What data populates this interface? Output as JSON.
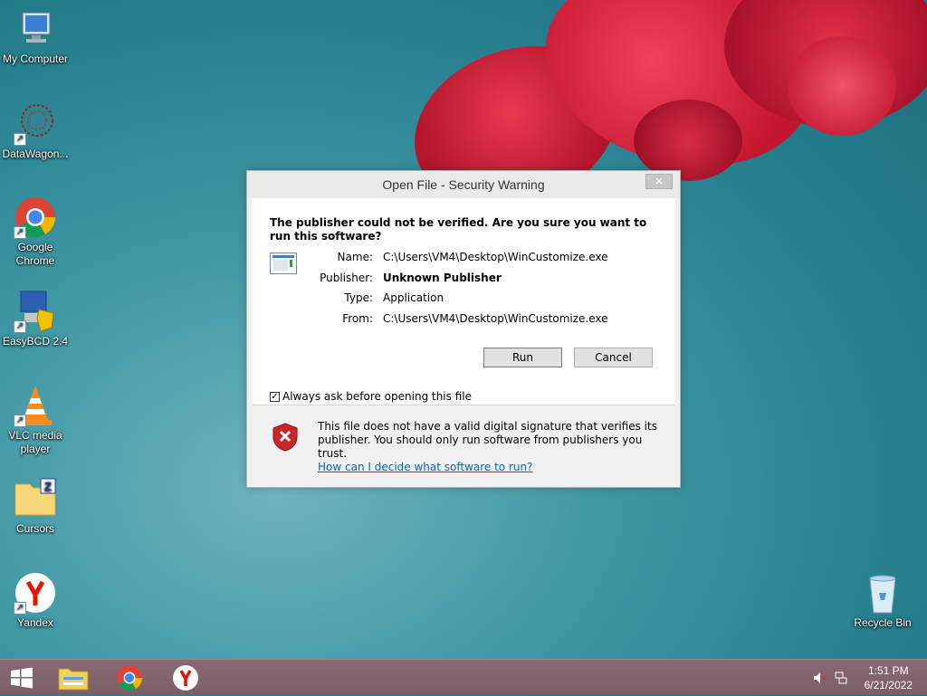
{
  "desktop": {
    "icons": [
      {
        "label": "My Computer"
      },
      {
        "label": "DataWagon..."
      },
      {
        "label": "Google\nChrome"
      },
      {
        "label": "EasyBCD 2.4"
      },
      {
        "label": "VLC media\nplayer"
      },
      {
        "label": "Cursors"
      },
      {
        "label": "Yandex"
      },
      {
        "label": "Recycle Bin"
      }
    ]
  },
  "dialog": {
    "title": "Open File - Security Warning",
    "close_glyph": "✕",
    "heading": "The publisher could not be verified.  Are you sure you want to run this software?",
    "fields": {
      "name_label": "Name:",
      "name_value": "C:\\Users\\VM4\\Desktop\\WinCustomize.exe",
      "publisher_label": "Publisher:",
      "publisher_value": "Unknown Publisher",
      "type_label": "Type:",
      "type_value": "Application",
      "from_label": "From:",
      "from_value": "C:\\Users\\VM4\\Desktop\\WinCustomize.exe"
    },
    "run_label": "Run",
    "cancel_label": "Cancel",
    "checkbox_label": "Always ask before opening this file",
    "checkbox_checked": true,
    "warning_text": "This file does not have a valid digital signature that verifies its publisher.  You should only run software from publishers you trust.",
    "help_link": "How can I decide what software to run?"
  },
  "taskbar": {
    "time": "1:51 PM",
    "date": "6/21/2022"
  },
  "colors": {
    "accent_link": "#0066cc",
    "taskbar": "#7a5e66",
    "shield_red": "#c9252c"
  }
}
